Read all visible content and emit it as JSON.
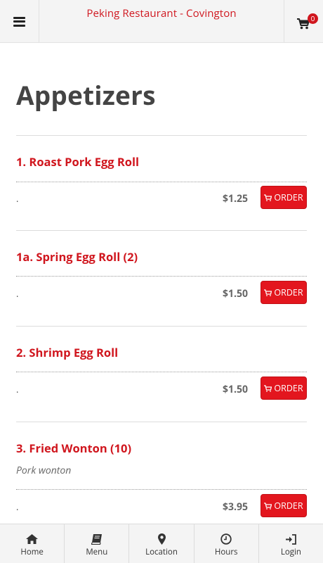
{
  "header": {
    "title": "Peking Restaurant - Covington",
    "cart_count": "0"
  },
  "section": {
    "title": "Appetizers"
  },
  "items": [
    {
      "name": "1. Roast Pork Egg Roll",
      "description": "",
      "dot": ".",
      "price": "$1.25",
      "order_label": "ORDER"
    },
    {
      "name": "1a. Spring Egg Roll (2)",
      "description": "",
      "dot": ".",
      "price": "$1.50",
      "order_label": "ORDER"
    },
    {
      "name": "2. Shrimp Egg Roll",
      "description": "",
      "dot": ".",
      "price": "$1.50",
      "order_label": "ORDER"
    },
    {
      "name": "3. Fried Wonton (10)",
      "description": "Pork wonton",
      "dot": ".",
      "price": "$3.95",
      "order_label": "ORDER"
    }
  ],
  "nav": [
    {
      "label": "Home",
      "icon": "home-icon"
    },
    {
      "label": "Menu",
      "icon": "book-icon"
    },
    {
      "label": "Location",
      "icon": "map-marker-icon"
    },
    {
      "label": "Hours",
      "icon": "clock-icon"
    },
    {
      "label": "Login",
      "icon": "sign-in-icon"
    }
  ],
  "colors": {
    "brand_red": "#d0161e",
    "button_red": "#e3161e",
    "header_bg": "#f4f4f4"
  }
}
